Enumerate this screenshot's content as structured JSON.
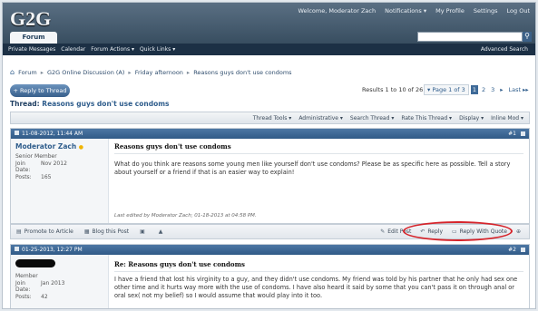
{
  "site": {
    "logo": "G2G"
  },
  "top_links": [
    "Welcome, Moderator Zach",
    "Notifications ▾",
    "My Profile",
    "Settings",
    "Log Out"
  ],
  "tabs": {
    "forum": "Forum"
  },
  "subnav": {
    "items": [
      "Private Messages",
      "Calendar",
      "Forum Actions ▾",
      "Quick Links ▾"
    ],
    "advanced": "Advanced Search"
  },
  "breadcrumb": [
    "Forum",
    "G2G Online Discussion (A)",
    "Friday afternoon",
    "Reasons guys don't use condoms"
  ],
  "reply_button": "+ Reply to Thread",
  "results": "Results 1 to 10 of 26",
  "pager": {
    "label": "▾ Page 1 of 3",
    "pages": [
      "1",
      "2",
      "3"
    ],
    "next": "▸",
    "last": "Last ▸▸"
  },
  "thread": {
    "prefix": "Thread:",
    "title": "Reasons guys don't use condoms"
  },
  "tools": [
    "Thread Tools ▾",
    "Administrative ▾",
    "Search Thread ▾",
    "Rate This Thread ▾",
    "Display ▾",
    "Inline Mod ▾"
  ],
  "posts": [
    {
      "date": "11-08-2012, 11:44 AM",
      "number": "#1",
      "username": "Moderator Zach",
      "usertitle": "Senior Member",
      "join_label": "Join Date:",
      "join_value": "Nov 2012",
      "posts_label": "Posts:",
      "posts_value": "165",
      "title": "Reasons guys don't use condoms",
      "body": "What do you think are reasons some young men like yourself don't use condoms? Please be as specific here as possible. Tell a story about yourself or a friend if that is an easier way to explain!",
      "edited": "Last edited by Moderator Zach; 01-18-2013 at 04:58 PM."
    },
    {
      "date": "01-25-2013, 12:27 PM",
      "number": "#2",
      "usertitle": "Member",
      "join_label": "Join Date:",
      "join_value": "Jan 2013",
      "posts_label": "Posts:",
      "posts_value": "42",
      "title": "Re: Reasons guys don't use condoms",
      "body": "I have a friend that lost his virginity to a guy, and they didn't use condoms. My friend was told by his partner that he only had sex one other time and it hurts way more with the use of condoms. I have also heard it said by some that you can't pass it on through anal or oral sex( not my belief) so I would assume that would play into it too."
    }
  ],
  "actions": {
    "promote": "Promote to Article",
    "blog": "Blog this Post",
    "edit": "Edit Post",
    "reply": "Reply",
    "reply_quote": "Reply With Quote"
  },
  "colors": {
    "header": "#2e4456",
    "accent": "#305a87",
    "highlight": "#d6242b"
  }
}
